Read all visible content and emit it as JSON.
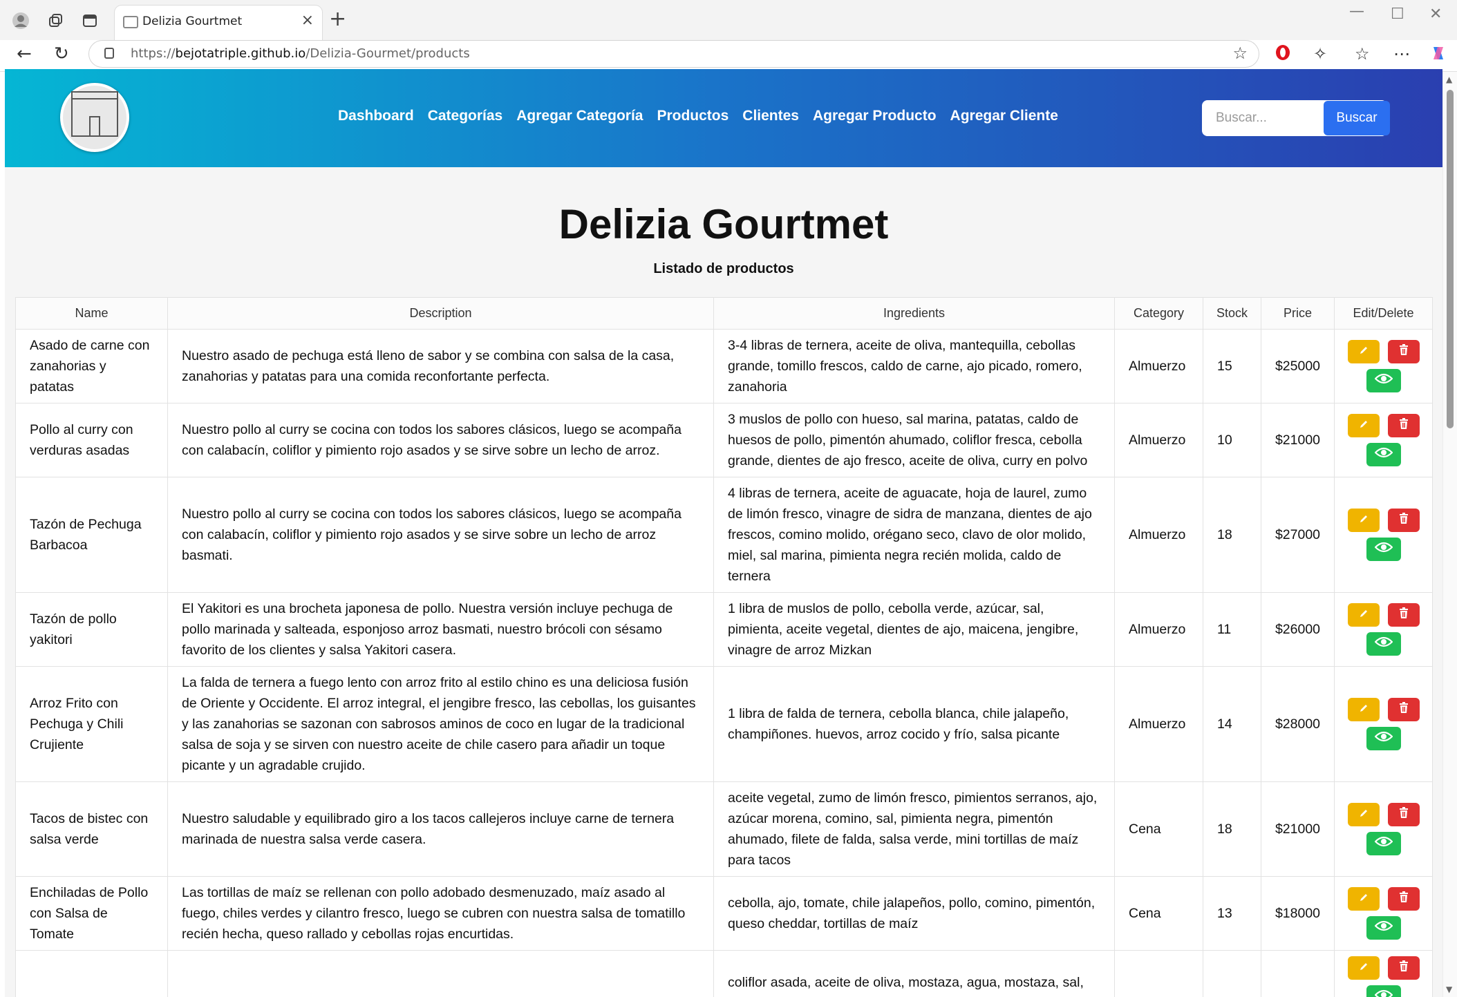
{
  "browser": {
    "tab_title": "Delizia Gourtmet",
    "url_scheme": "https://",
    "url_host": "bejotatriple.github.io",
    "url_path": "/Delizia-Gourmet/products"
  },
  "nav": {
    "links": [
      "Dashboard",
      "Categorías",
      "Agregar Categoría",
      "Productos",
      "Clientes",
      "Agregar Producto",
      "Agregar Cliente"
    ]
  },
  "search": {
    "placeholder": "Buscar...",
    "button": "Buscar"
  },
  "page": {
    "title": "Delizia Gourtmet",
    "subtitle": "Listado de productos"
  },
  "table": {
    "headers": [
      "Name",
      "Description",
      "Ingredients",
      "Category",
      "Stock",
      "Price",
      "Edit/Delete"
    ],
    "rows": [
      {
        "name": "Asado de carne con zanahorias y patatas",
        "description": "Nuestro asado de pechuga está lleno de sabor y se combina con salsa de la casa, zanahorias y patatas para una comida reconfortante perfecta.",
        "ingredients": "3-4 libras de ternera, aceite de oliva, mantequilla, cebollas grande, tomillo frescos, caldo de carne, ajo picado, romero, zanahoria",
        "category": "Almuerzo",
        "stock": "15",
        "price": "$25000"
      },
      {
        "name": "Pollo al curry con verduras asadas",
        "description": "Nuestro pollo al curry se cocina con todos los sabores clásicos, luego se acompaña con calabacín, coliflor y pimiento rojo asados y se sirve sobre un lecho de arroz.",
        "ingredients": "3 muslos de pollo con hueso, sal marina, patatas, caldo de huesos de pollo, pimentón ahumado, coliflor fresca, cebolla grande, dientes de ajo fresco, aceite de oliva, curry en polvo",
        "category": "Almuerzo",
        "stock": "10",
        "price": "$21000"
      },
      {
        "name": "Tazón de Pechuga Barbacoa",
        "description": "Nuestro pollo al curry se cocina con todos los sabores clásicos, luego se acompaña con calabacín, coliflor y pimiento rojo asados y se sirve sobre un lecho de arroz basmati.",
        "ingredients": "4 libras de ternera, aceite de aguacate, hoja de laurel, zumo de limón fresco, vinagre de sidra de manzana, dientes de ajo frescos, comino molido, orégano seco, clavo de olor molido, miel, sal marina, pimienta negra recién molida, caldo de ternera",
        "category": "Almuerzo",
        "stock": "18",
        "price": "$27000"
      },
      {
        "name": "Tazón de pollo yakitori",
        "description": "El Yakitori es una brocheta japonesa de pollo. Nuestra versión incluye pechuga de pollo marinada y salteada, esponjoso arroz basmati, nuestro brócoli con sésamo favorito de los clientes y salsa Yakitori casera.",
        "ingredients": "1 libra de muslos de pollo, cebolla verde, azúcar, sal, pimienta, aceite vegetal, dientes de ajo, maicena, jengibre, vinagre de arroz Mizkan",
        "category": "Almuerzo",
        "stock": "11",
        "price": "$26000"
      },
      {
        "name": "Arroz Frito con Pechuga y Chili Crujiente",
        "description": "La falda de ternera a fuego lento con arroz frito al estilo chino es una deliciosa fusión de Oriente y Occidente. El arroz integral, el jengibre fresco, las cebollas, los guisantes y las zanahorias se sazonan con sabrosos aminos de coco en lugar de la tradicional salsa de soja y se sirven con nuestro aceite de chile casero para añadir un toque picante y un agradable crujido.",
        "ingredients": "1 libra de falda de ternera, cebolla blanca, chile jalapeño, champiñones. huevos, arroz cocido y frío, salsa picante",
        "category": "Almuerzo",
        "stock": "14",
        "price": "$28000"
      },
      {
        "name": "Tacos de bistec con salsa verde",
        "description": "Nuestro saludable y equilibrado giro a los tacos callejeros incluye carne de ternera marinada de nuestra salsa verde casera.",
        "ingredients": "aceite vegetal, zumo de limón fresco, pimientos serranos, ajo, azúcar morena, comino, sal, pimienta negra, pimentón ahumado, filete de falda, salsa verde, mini tortillas de maíz para tacos",
        "category": "Cena",
        "stock": "18",
        "price": "$21000"
      },
      {
        "name": "Enchiladas de Pollo con Salsa de Tomate",
        "description": "Las tortillas de maíz se rellenan con pollo adobado desmenuzado, maíz asado al fuego, chiles verdes y cilantro fresco, luego se cubren con nuestra salsa de tomatillo recién hecha, queso rallado y cebollas rojas encurtidas.",
        "ingredients": "cebolla, ajo, tomate, chile jalapeños, pollo, comino, pimentón, queso cheddar, tortillas de maíz",
        "category": "Cena",
        "stock": "13",
        "price": "$18000"
      },
      {
        "name": "",
        "description": "",
        "ingredients": "coliflor asada, aceite de oliva, mostaza, agua, mostaza, sal,",
        "category": "",
        "stock": "",
        "price": ""
      }
    ]
  },
  "icons": {
    "edit": "pencil-icon",
    "delete": "trash-icon",
    "view": "eye-icon",
    "colors": {
      "edit": "#f0b400",
      "delete": "#e03131",
      "view": "#1fbf55",
      "search_button": "#2b6ff0"
    }
  }
}
